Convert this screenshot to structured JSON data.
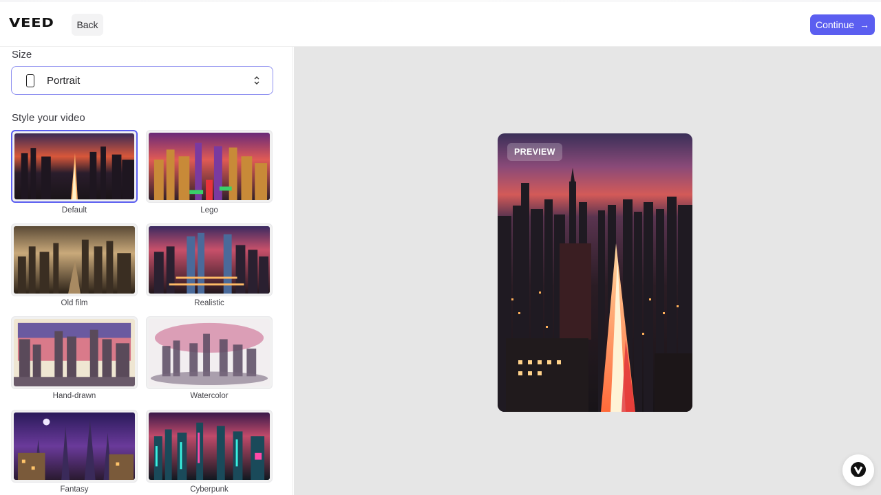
{
  "header": {
    "logo": "VEED",
    "back_label": "Back",
    "continue_label": "Continue",
    "accent_color": "#5b5ef0"
  },
  "size": {
    "label": "Size",
    "selected_value": "Portrait",
    "icon": "phone-portrait-icon"
  },
  "style": {
    "label": "Style your video",
    "selected": "Default",
    "options": [
      {
        "label": "Default"
      },
      {
        "label": "Lego"
      },
      {
        "label": "Old film"
      },
      {
        "label": "Realistic"
      },
      {
        "label": "Hand-drawn"
      },
      {
        "label": "Watercolor"
      },
      {
        "label": "Fantasy"
      },
      {
        "label": "Cyberpunk"
      }
    ]
  },
  "preview": {
    "badge": "PREVIEW"
  },
  "help": {
    "icon": "veed-chat-icon"
  }
}
